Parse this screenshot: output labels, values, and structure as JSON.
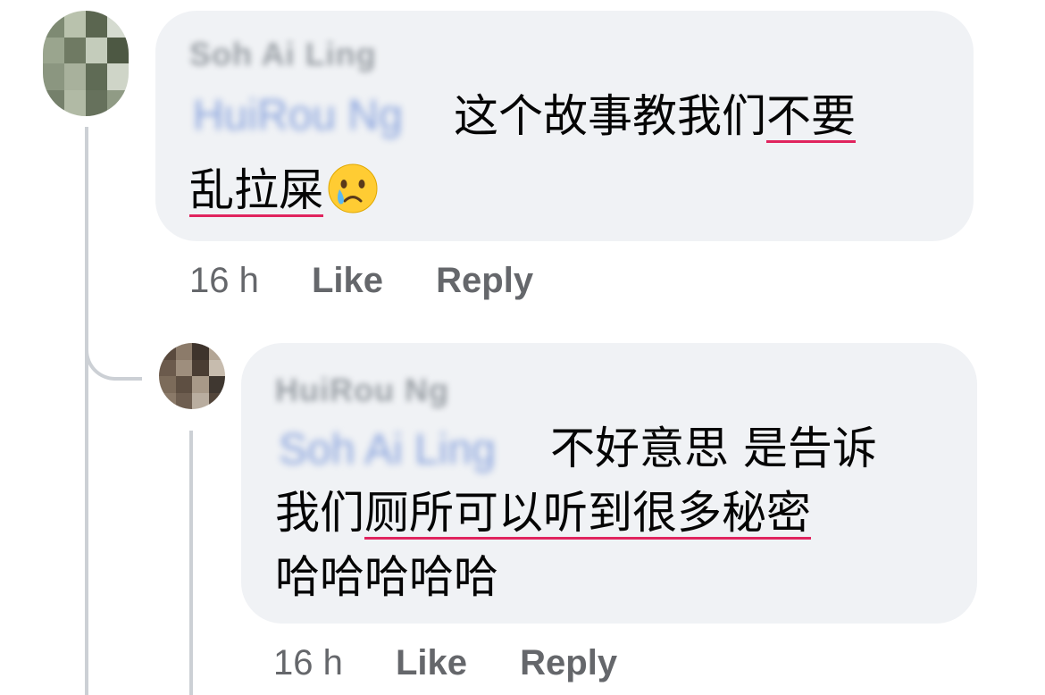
{
  "comments": [
    {
      "author": "Soh Ai Ling",
      "mention": "HuiRou Ng",
      "text_line1_plain": "这个故事教我们",
      "text_line1_underlined": "不要",
      "text_line2_underlined": "乱拉屎",
      "emoji": "crying-face",
      "time": "16 h",
      "like_label": "Like",
      "reply_label": "Reply",
      "avatar_colors": [
        "#7e8a73",
        "#b9c2ad",
        "#5b6650",
        "#d5dbd0",
        "#9aa58e",
        "#6f7a63",
        "#c4ccbb",
        "#4d5843",
        "#8b9680",
        "#a8b19c",
        "#5f6b55",
        "#cfd5c8",
        "#75806b",
        "#b1baa5",
        "#66715c",
        "#909b85"
      ]
    },
    {
      "author": "HuiRou Ng",
      "mention": "Soh Ai Ling",
      "text_line1": "不好意思 是告诉",
      "text_line2_plain": "我们",
      "text_line2_underlined": "厕所可以听到很多秘密",
      "text_line3": "哈哈哈哈哈",
      "time": "16 h",
      "like_label": "Like",
      "reply_label": "Reply",
      "avatar_colors": [
        "#5a4a3e",
        "#8c7b6a",
        "#3e342c",
        "#b3a595",
        "#6b5a4c",
        "#9e8e7d",
        "#4a3d33",
        "#c7bcae",
        "#7c6b5a",
        "#5e4f42",
        "#a89988",
        "#3f3730",
        "#8a7968",
        "#6e5e50",
        "#b9ad9f",
        "#52453a"
      ]
    }
  ],
  "colors": {
    "bubble": "#f0f2f5",
    "meta_text": "#65676b",
    "thread_line": "#ccd0d5",
    "underline": "#e0245e",
    "mention_blur": "#8aa4dd"
  }
}
